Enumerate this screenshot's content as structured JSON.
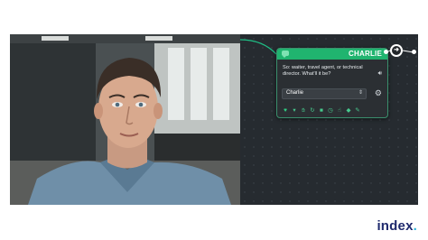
{
  "node": {
    "title": "CHARLIE",
    "message": "So: waiter, travel agent, or technical director. What'll it be?",
    "speaker_select": {
      "selected": "Charlie"
    },
    "icons": [
      "chat-icon",
      "speaker-icon",
      "gear-icon",
      "heart-icon",
      "thumbs-down-icon",
      "hand-icon",
      "loop-icon",
      "stop-icon",
      "clock-icon",
      "pointer-icon",
      "tag-icon",
      "pencil-icon"
    ]
  },
  "logo": {
    "text": "index",
    "dot": "."
  },
  "colors": {
    "node_header": "#20b46f",
    "canvas": "#262b30",
    "logo": "#1f2a6d",
    "logo_dot": "#2bb3d9"
  }
}
